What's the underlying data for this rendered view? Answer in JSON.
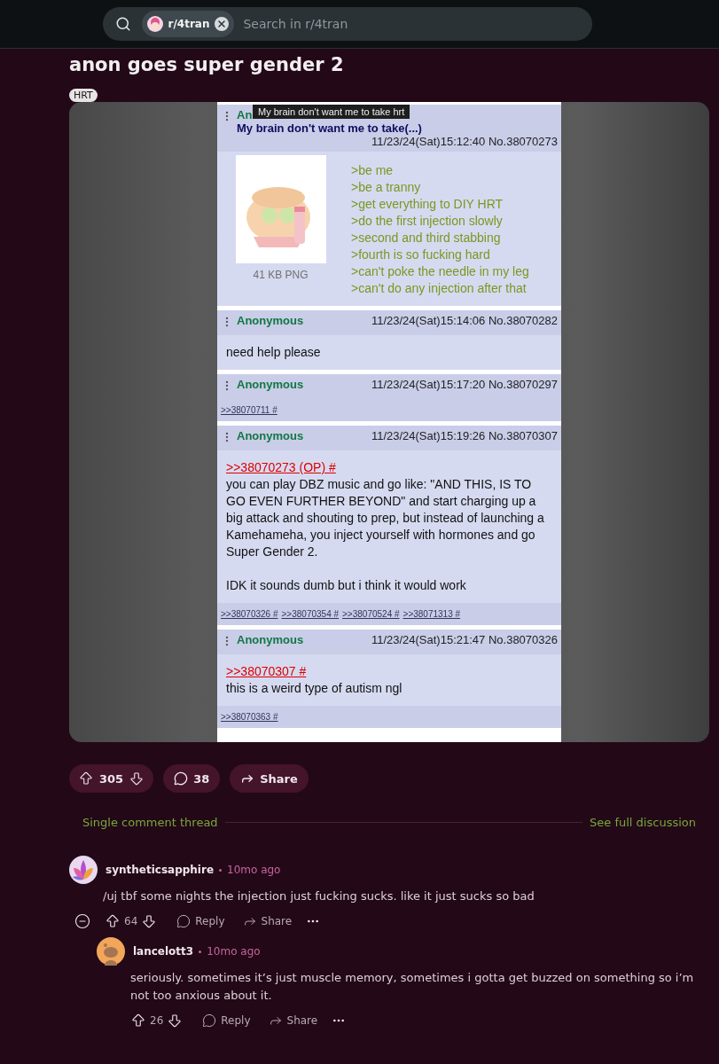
{
  "search": {
    "community": "r/4tran",
    "placeholder": "Search in r/4tran"
  },
  "post": {
    "title": "anon goes super gender 2",
    "flair": "HRT",
    "screenshot": {
      "tooltip": "My brain don't want me to take hrt",
      "posts": [
        {
          "name": "An",
          "subject": "My brain don't want me to take(...)",
          "datetime": "11/23/24(Sat)15:12:40 No.38070273",
          "image": {
            "kind": "picture",
            "caption": "41 KB PNG"
          },
          "body": [
            {
              "kind": "greentext",
              "text": ">be me"
            },
            {
              "kind": "greentext",
              "text": ">be a tranny"
            },
            {
              "kind": "greentext",
              "text": ">get everything to DIY HRT"
            },
            {
              "kind": "greentext",
              "text": ">do the first injection slowly"
            },
            {
              "kind": "greentext",
              "text": ">second and third stabbing"
            },
            {
              "kind": "greentext",
              "text": ">fourth is so fucking hard"
            },
            {
              "kind": "greentext",
              "text": ">can't poke the needle in my leg"
            },
            {
              "kind": "greentext",
              "text": ">can't do any injection after that"
            }
          ]
        },
        {
          "name": "Anonymous",
          "datetime": "11/23/24(Sat)15:14:06 No.38070282",
          "body": [
            {
              "kind": "text",
              "text": "need help please"
            }
          ]
        },
        {
          "name": "Anonymous",
          "datetime": "11/23/24(Sat)15:17:20 No.38070297",
          "replies": [
            ">>38070711 #"
          ]
        },
        {
          "name": "Anonymous",
          "datetime": "11/23/24(Sat)15:19:26 No.38070307",
          "body": [
            {
              "kind": "quotelink",
              "text": ">>38070273 (OP) #"
            },
            {
              "kind": "text",
              "text": "you can play DBZ music and go like: \"AND THIS, IS TO GO EVEN FURTHER BEYOND\" and start charging up a big attack and shouting to prep, but instead of launching a Kamehameha, you inject yourself with hormones and go Super Gender 2."
            },
            {
              "kind": "text",
              "text": "IDK it sounds dumb but i think it would work"
            }
          ],
          "replies": [
            ">>38070326 #",
            ">>38070354 #",
            ">>38070524 #",
            ">>38071313 #"
          ]
        },
        {
          "name": "Anonymous",
          "datetime": "11/23/24(Sat)15:21:47 No.38070326",
          "body": [
            {
              "kind": "quotelink",
              "text": ">>38070307 #"
            },
            {
              "kind": "text",
              "text": "this is a weird type of autism ngl"
            }
          ],
          "replies": [
            ">>38070363 #"
          ]
        }
      ]
    }
  },
  "actions": {
    "votes": "305",
    "comments": "38",
    "share": "Share"
  },
  "thread_bar": {
    "label": "Single comment thread",
    "link": "See full discussion"
  },
  "comments": [
    {
      "author": "syntheticsapphire",
      "kind": "lotus",
      "time": "10mo ago",
      "body": "/uj tbf some nights the injection just fucking sucks. like it just sucks so bad",
      "votes": "64",
      "reply": "Reply",
      "share": "Share",
      "collapsible": true,
      "children": [
        {
          "author": "lancelott3",
          "kind": "snoo",
          "time": "10mo ago",
          "body": "seriously. sometimes it’s just muscle memory, sometimes i gotta get buzzed on something so i’m not too anxious about it.",
          "votes": "26",
          "reply": "Reply",
          "share": "Share",
          "collapsible": false
        }
      ]
    }
  ]
}
